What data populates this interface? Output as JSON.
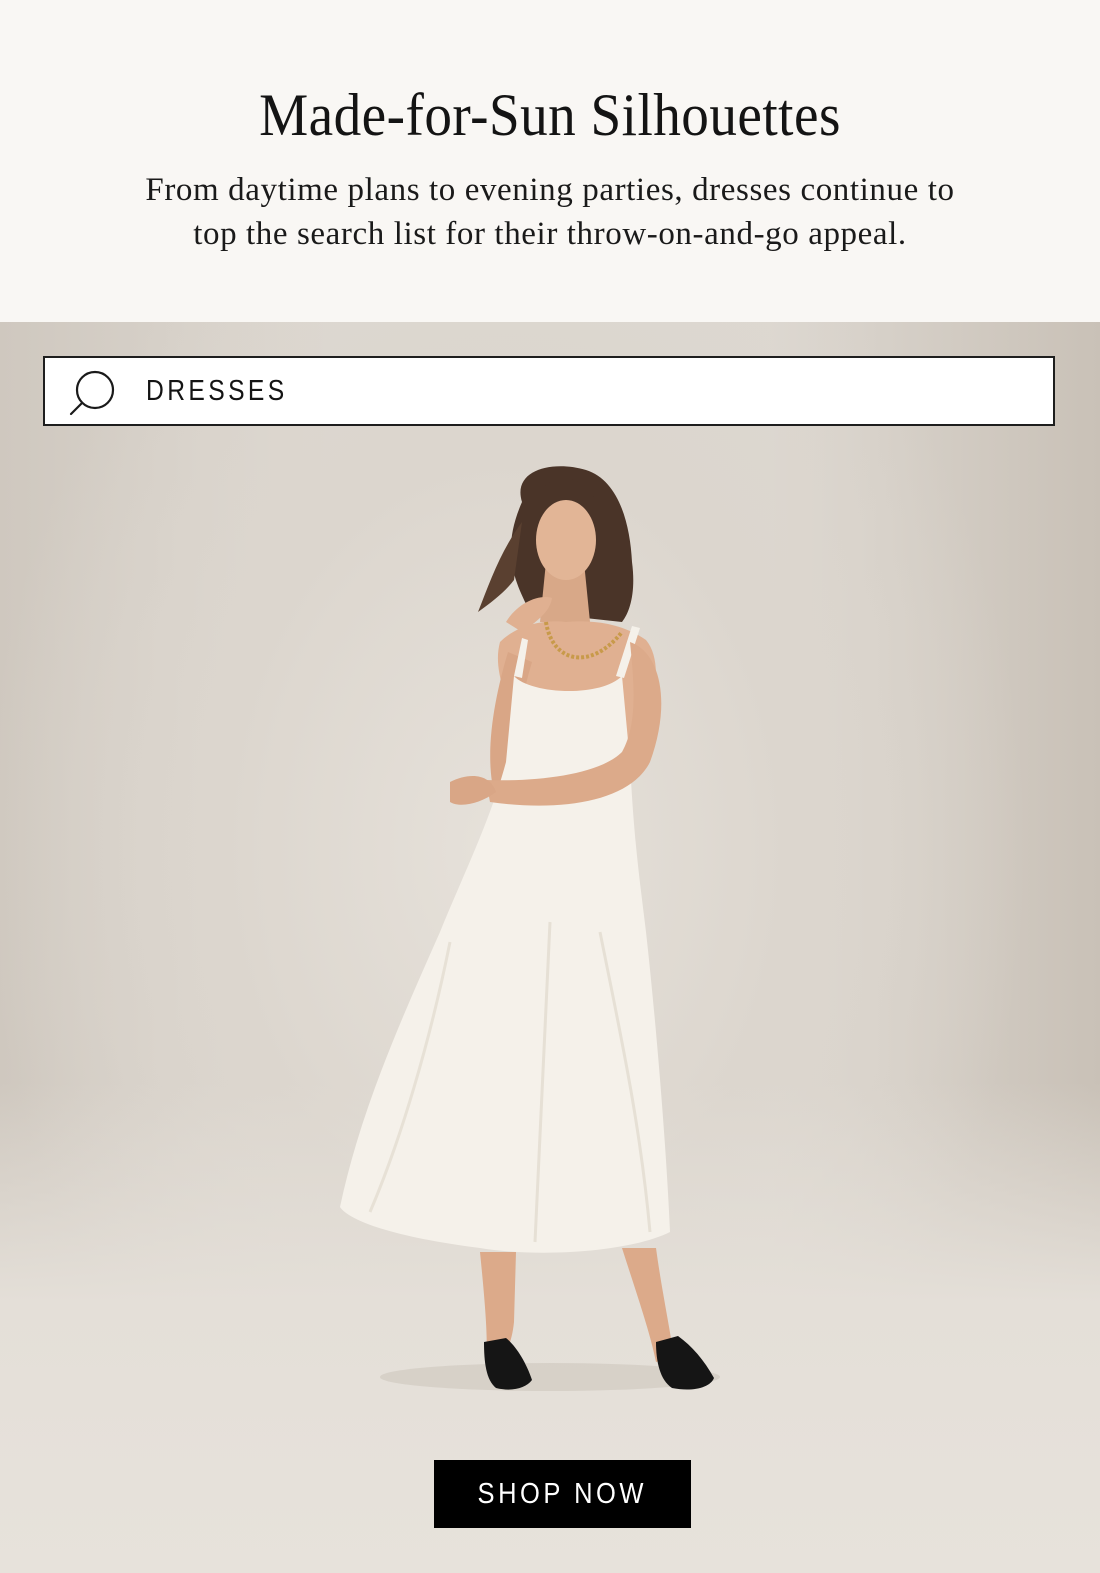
{
  "header": {
    "headline": "Made-for-Sun Silhouettes",
    "subcopy_line1": "From daytime plans to evening parties, dresses continue to",
    "subcopy_line2": "top the search list for their throw-on-and-go appeal."
  },
  "search": {
    "query": "DRESSES",
    "icon": "search-icon"
  },
  "hero": {
    "image_subject": "model-in-white-midi-dress"
  },
  "cta": {
    "label": "SHOP NOW"
  },
  "colors": {
    "header_bg": "#f9f7f4",
    "hero_bg": "#ddd8d1",
    "button_bg": "#000000",
    "button_text": "#ffffff"
  }
}
